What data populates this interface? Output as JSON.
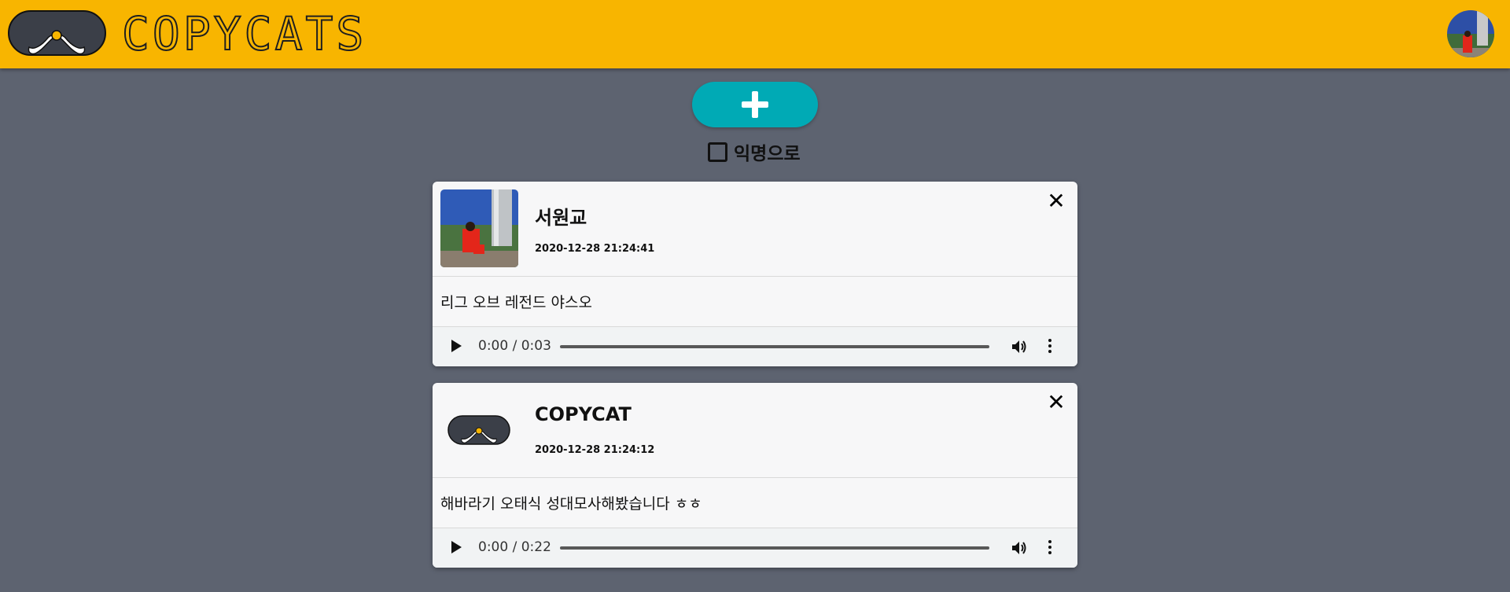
{
  "header": {
    "logo_text": "COPYCATS",
    "logo_icon": "mustache-mask-icon",
    "avatar_icon": "user-avatar"
  },
  "composer": {
    "add_icon": "plus-icon",
    "anonymous_label": "익명으로",
    "anonymous_checked": false
  },
  "posts": [
    {
      "author": "서원교",
      "timestamp": "2020-12-28 21:24:41",
      "text": "리그 오브 레전드 야스오",
      "audio_time": "0:00 / 0:03",
      "thumbnail": "user-photo"
    },
    {
      "author": "COPYCAT",
      "timestamp": "2020-12-28 21:24:12",
      "text": "해바라기 오태식 성대모사해봤습니다 ㅎㅎ",
      "audio_time": "0:00 / 0:22",
      "thumbnail": "mustache-mask-icon"
    }
  ],
  "colors": {
    "header_bg": "#f8b500",
    "page_bg": "#5d6370",
    "add_button": "#00aab5",
    "card_bg": "#f7f7f8"
  }
}
